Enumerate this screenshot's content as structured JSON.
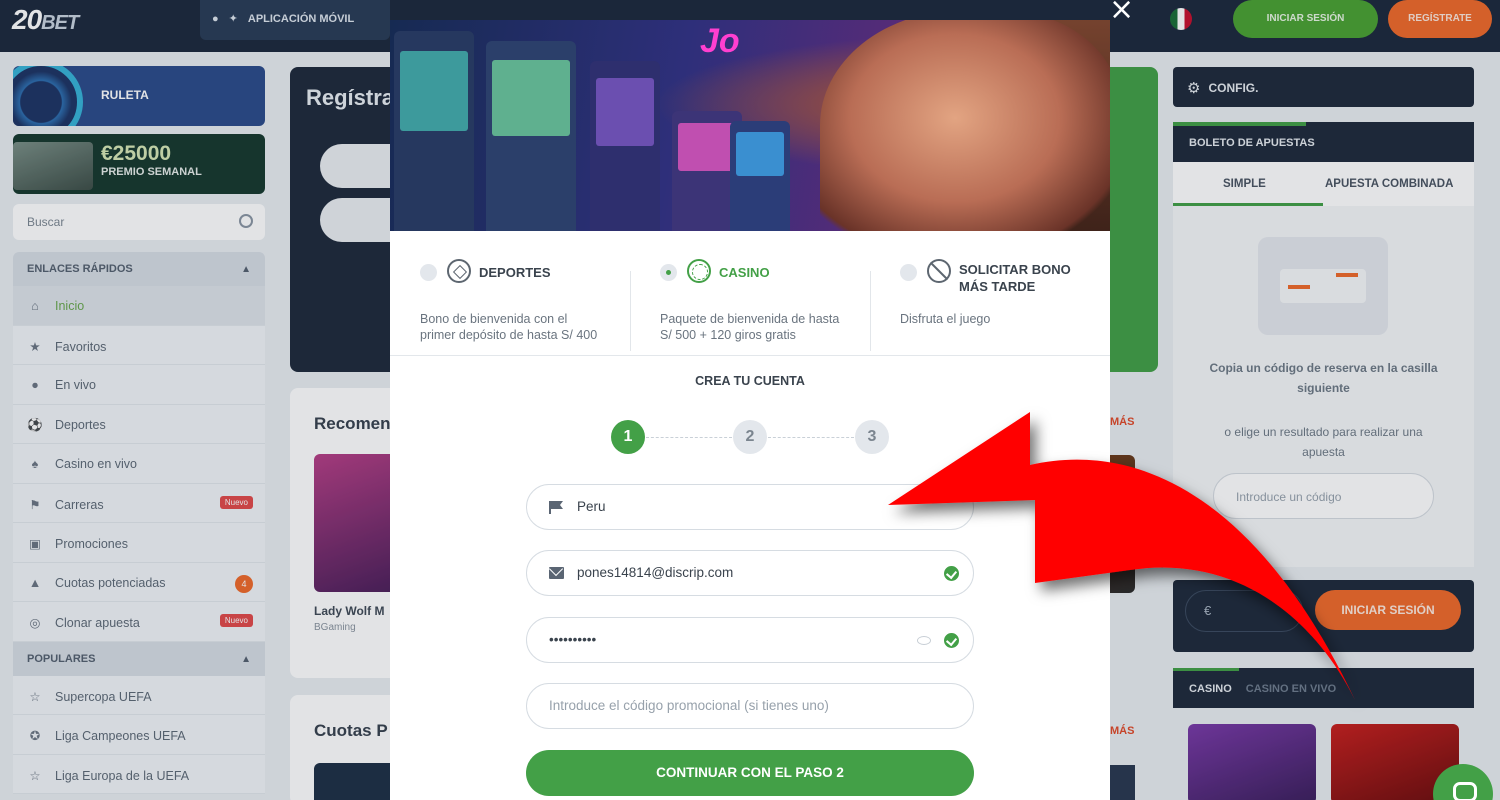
{
  "header": {
    "logo_number": "20",
    "logo_word": "BET",
    "nav_active": "APLICACIÓN MÓVIL",
    "login": "INICIAR SESIÓN",
    "register": "REGÍSTRATE"
  },
  "sidebar": {
    "ruleta": "RULETA",
    "premio_amount": "€25000",
    "premio_label": "PREMIO SEMANAL",
    "search_placeholder": "Buscar",
    "quick_links_title": "ENLACES RÁPIDOS",
    "quick_links": [
      {
        "label": "Inicio",
        "icon": "home-icon"
      },
      {
        "label": "Favoritos",
        "icon": "star-icon"
      },
      {
        "label": "En vivo",
        "icon": "live-icon"
      },
      {
        "label": "Deportes",
        "icon": "sports-icon"
      },
      {
        "label": "Casino en vivo",
        "icon": "cards-icon"
      },
      {
        "label": "Carreras",
        "icon": "racing-icon",
        "badge": "Nuevo"
      },
      {
        "label": "Promociones",
        "icon": "gift-icon"
      },
      {
        "label": "Cuotas potenciadas",
        "icon": "boost-icon",
        "badge": "4"
      },
      {
        "label": "Clonar apuesta",
        "icon": "clone-icon",
        "badge": "Nuevo"
      }
    ],
    "popular_title": "POPULARES",
    "popular": [
      {
        "label": "Supercopa UEFA",
        "icon": "trophy-icon"
      },
      {
        "label": "Liga Campeones UEFA",
        "icon": "ucl-icon"
      },
      {
        "label": "Liga Europa de la UEFA",
        "icon": "cup-icon"
      }
    ]
  },
  "main": {
    "register_title": "Regístra",
    "recommended_title": "Recomen",
    "more": "MÁS",
    "game_name": "Lady Wolf M",
    "game_provider": "BGaming",
    "cuotas_title": "Cuotas P"
  },
  "right": {
    "config": "CONFIG.",
    "boleto": "BOLETO DE APUESTAS",
    "tab_simple": "SIMPLE",
    "tab_combined": "APUESTA COMBINADA",
    "copy_text": "Copia un código de reserva en la casilla siguiente",
    "or_text": "o elige un resultado para realizar una apuesta",
    "code_placeholder": "Introduce un código",
    "currency": "€",
    "login_button": "INICIAR SESIÓN",
    "casino_tab": "CASINO",
    "casino_live_tab": "CASINO EN VIVO"
  },
  "modal": {
    "close": "×",
    "neon_text": "Jo",
    "bonuses": [
      {
        "title": "DEPORTES",
        "desc": "Bono de bienvenida con el primer depósito de hasta S/ 400",
        "icon": "soccer-ball-icon",
        "selected": false
      },
      {
        "title": "CASINO",
        "desc": "Paquete de bienvenida de hasta S/ 500 + 120 giros gratis",
        "icon": "roulette-icon",
        "selected": true
      },
      {
        "title": "SOLICITAR BONO MÁS TARDE",
        "desc": "Disfruta el juego",
        "icon": "ban-icon",
        "selected": false
      }
    ],
    "create_account": "CREA TU CUENTA",
    "steps": [
      "1",
      "2",
      "3"
    ],
    "active_step": 1,
    "country": "Peru",
    "email": "pones14814@discrip.com",
    "password_mask": "••••••••••",
    "promo_placeholder": "Introduce el código promocional (si tienes uno)",
    "continue": "CONTINUAR CON EL PASO 2"
  },
  "colors": {
    "accent_green": "#43a047",
    "accent_orange": "#ef6a2b",
    "navy": "#1f2b3c",
    "arrow_red": "#ff0000"
  }
}
